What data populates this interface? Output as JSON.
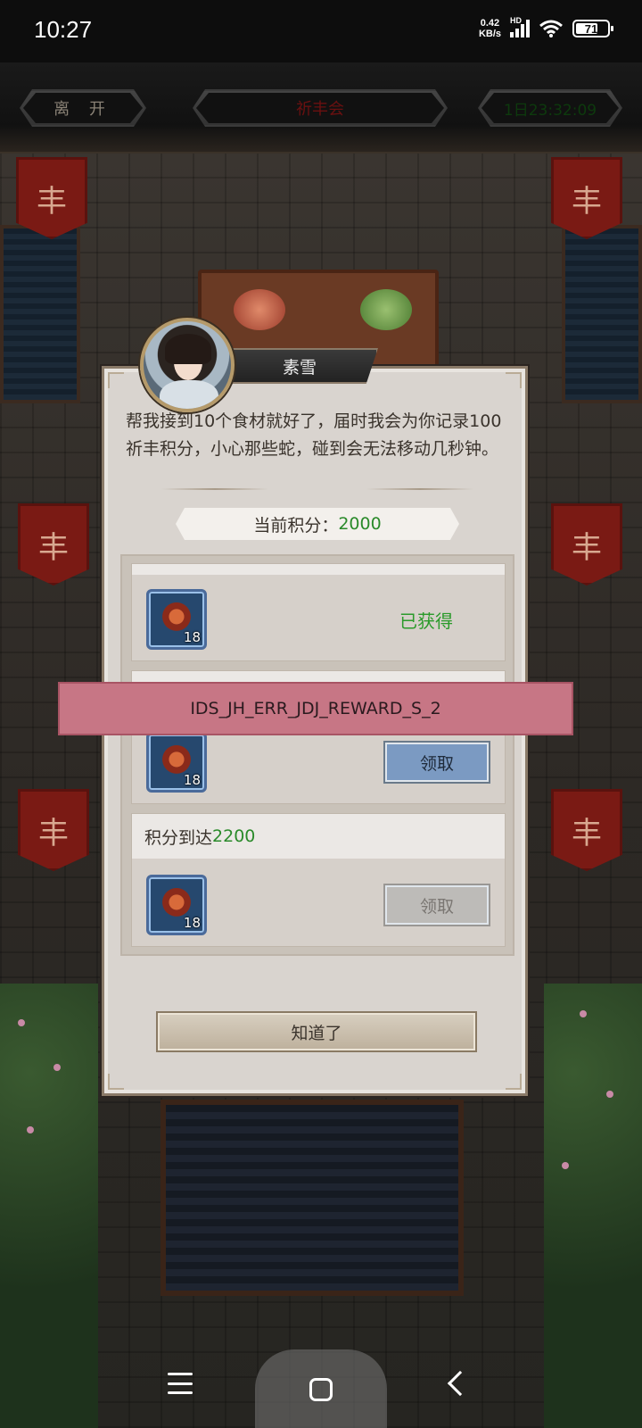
{
  "status_bar": {
    "time": "10:27",
    "net_speed_value": "0.42",
    "net_speed_unit": "KB/s",
    "network_type": "HD",
    "battery": "71",
    "battery_level": 0.71
  },
  "top_bar": {
    "leave_label": "离 开",
    "event_title": "祈丰会",
    "countdown": "1日23:32:09"
  },
  "scene": {
    "banner_glyph": "丰"
  },
  "dialog": {
    "npc_name": "素雪",
    "message": "帮我接到10个食材就好了，届时我会为你记录100祈丰积分，小心那些蛇，碰到会无法移动几秒钟。",
    "score_label": "当前积分：",
    "score_value": "2000",
    "rewards": [
      {
        "header_label": "",
        "header_target": "",
        "item_count": "18",
        "status": "已获得",
        "state": "obtained"
      },
      {
        "header_label": "",
        "header_target": "",
        "item_count": "18",
        "button_label": "领取",
        "state": "claimable"
      },
      {
        "header_label": "积分到达",
        "header_target": "2200",
        "item_count": "18",
        "button_label": "领取",
        "state": "locked"
      }
    ],
    "confirm_label": "知道了"
  },
  "toast": {
    "text": "IDS_JH_ERR_JDJ_REWARD_S_2"
  },
  "colors": {
    "highlight_green": "#2a8a2a",
    "toast_bg": "#c77685",
    "claim_active": "#7b9ac2",
    "dialog_bg": "#d9d4cf"
  },
  "icons": {
    "reward_item": "battle-flag-icon",
    "nav_menu": "menu-icon",
    "nav_home": "home-icon",
    "nav_back": "back-icon"
  }
}
